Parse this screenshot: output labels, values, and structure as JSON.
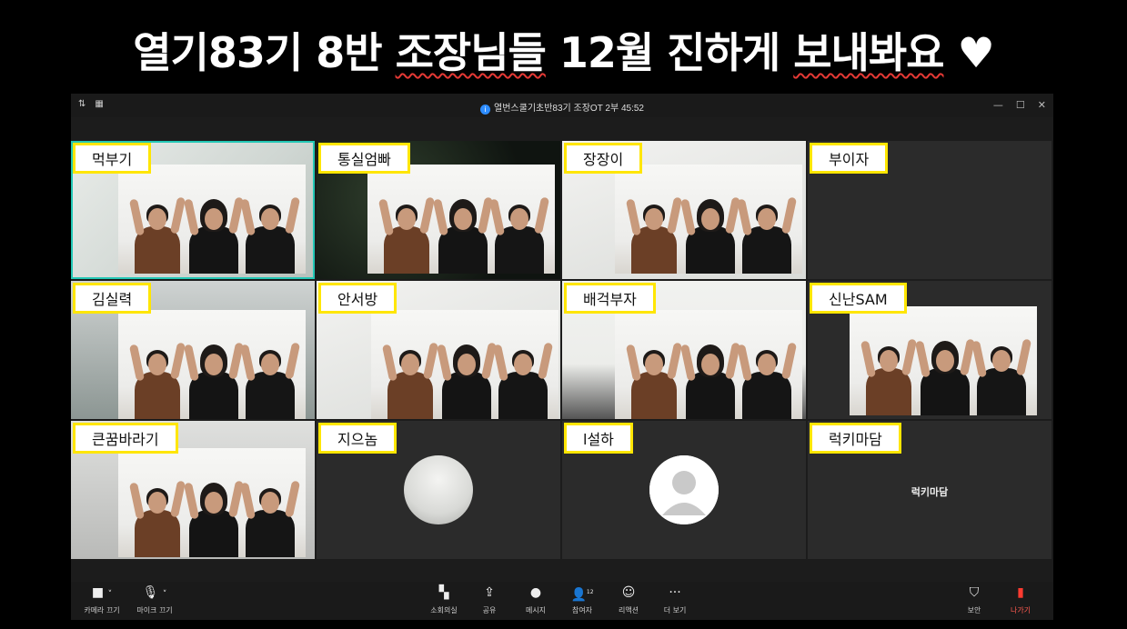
{
  "headline": {
    "part1": "열기83기 8반 ",
    "part2": "조장님들",
    "part3": " 12월 진하게 ",
    "part4": "보내봐요",
    "part5": " ♥"
  },
  "window": {
    "meeting_title": "열번스쿨기초반83기 조장OT 2부 45:52",
    "controls": [
      "—",
      "☐",
      "✕"
    ]
  },
  "participants": [
    {
      "name": "먹부기"
    },
    {
      "name": "통실엄빠"
    },
    {
      "name": "장장이"
    },
    {
      "name": "부이자"
    },
    {
      "name": "김실력"
    },
    {
      "name": "안서방"
    },
    {
      "name": "배걱부자"
    },
    {
      "name": "신난SAM"
    },
    {
      "name": "큰꿈바라기"
    },
    {
      "name": "지으놈"
    },
    {
      "name": "l설하"
    },
    {
      "name": "럭키마담",
      "center_name": "럭키마담"
    }
  ],
  "toolbar": {
    "left": [
      {
        "label": "카메라 끄기",
        "icon": "camera-icon"
      },
      {
        "label": "마이크 끄기",
        "icon": "mic-icon"
      }
    ],
    "center": [
      {
        "label": "소회의실",
        "icon": "breakout-icon"
      },
      {
        "label": "공유",
        "icon": "share-icon"
      },
      {
        "label": "메시지",
        "icon": "chat-icon"
      },
      {
        "label": "참여자",
        "icon": "participants-icon",
        "badge": "12"
      },
      {
        "label": "리액션",
        "icon": "reaction-icon"
      },
      {
        "label": "더 보기",
        "icon": "more-icon"
      }
    ],
    "right": [
      {
        "label": "보안",
        "icon": "security-icon"
      },
      {
        "label": "나가기",
        "icon": "leave-icon"
      }
    ]
  },
  "colors": {
    "label_border": "#ffe600",
    "active_speaker": "#23c7b5",
    "leave": "#ff3b30"
  }
}
